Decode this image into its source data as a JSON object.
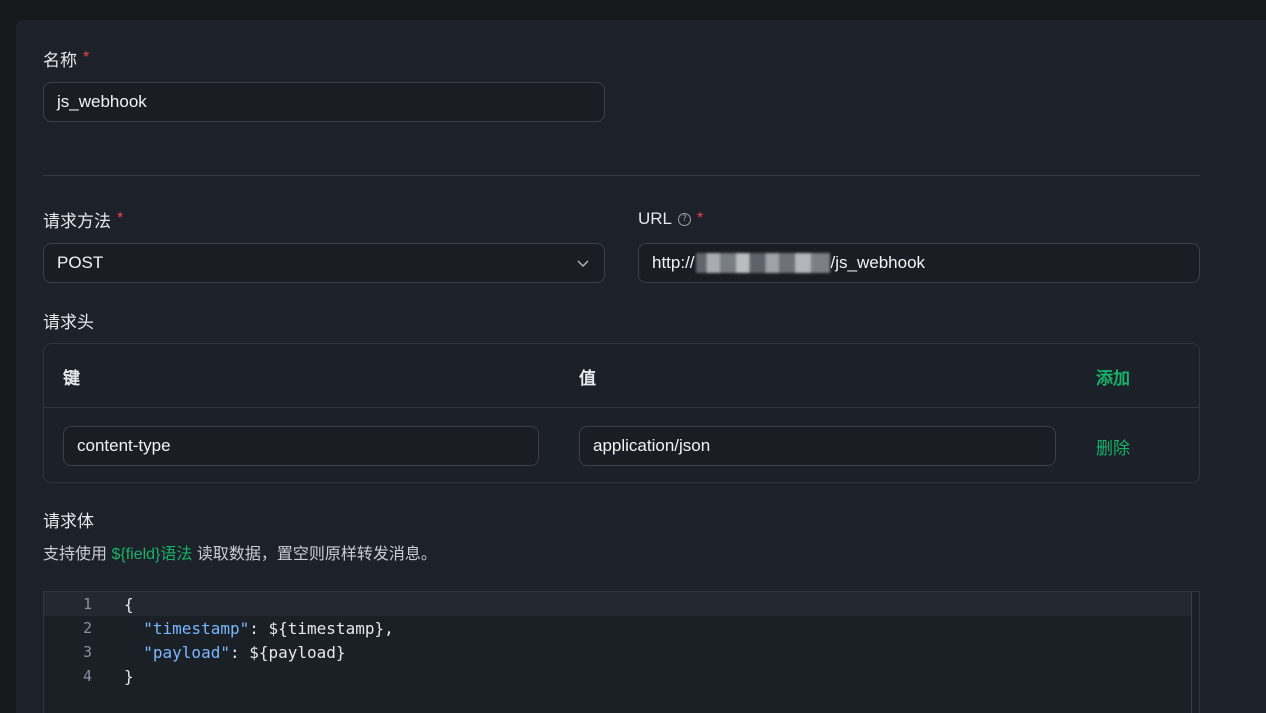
{
  "form": {
    "name": {
      "label": "名称",
      "required": "*",
      "value": "js_webhook"
    },
    "method": {
      "label": "请求方法",
      "required": "*",
      "value": "POST"
    },
    "url": {
      "label": "URL",
      "help": "?",
      "required": "*",
      "prefix": "http://",
      "suffix": "/js_webhook"
    },
    "headers": {
      "label": "请求头",
      "columns": {
        "key": "键",
        "value": "值",
        "add": "添加"
      },
      "rows": [
        {
          "key": "content-type",
          "value": "application/json",
          "delete": "删除"
        }
      ]
    },
    "body": {
      "label": "请求体",
      "hint_before": "支持使用 ",
      "hint_link": "${field}语法",
      "hint_after": " 读取数据，置空则原样转发消息。",
      "lines": [
        {
          "num": "1",
          "pre": "{",
          "str": "",
          "post": ""
        },
        {
          "num": "2",
          "pre": "  ",
          "str": "\"timestamp\"",
          "post": ": ${timestamp},"
        },
        {
          "num": "3",
          "pre": "  ",
          "str": "\"payload\"",
          "post": ": ${payload}"
        },
        {
          "num": "4",
          "pre": "}",
          "str": "",
          "post": ""
        }
      ]
    }
  },
  "colors": {
    "accent": "#17b26a",
    "required": "#f0414a",
    "background": "#1d2129"
  }
}
